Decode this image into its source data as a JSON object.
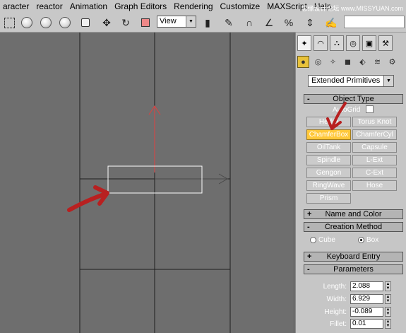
{
  "menubar": {
    "items": [
      "aracter",
      "reactor",
      "Animation",
      "Graph Editors",
      "Rendering",
      "Customize",
      "MAXScript",
      "Help"
    ],
    "watermark": "思缘设计论坛 www.MISSYUAN.com"
  },
  "toolbar": {
    "view_select": "View"
  },
  "panel": {
    "category_select": "Extended Primitives",
    "object_type": {
      "title": "Object Type",
      "sign": "-",
      "autogrid_label": "AutoGrid"
    },
    "buttons": [
      "Hedra",
      "Torus Knot",
      "ChamferBox",
      "ChamferCyl",
      "OilTank",
      "Capsule",
      "Spindle",
      "L-Ext",
      "Gengon",
      "C-Ext",
      "RingWave",
      "Hose",
      "Prism"
    ],
    "active_button": "ChamferBox",
    "name_and_color": {
      "title": "Name and Color",
      "sign": "+"
    },
    "creation_method": {
      "title": "Creation Method",
      "sign": "-",
      "options": [
        "Cube",
        "Box"
      ],
      "selected": "Box"
    },
    "keyboard_entry": {
      "title": "Keyboard Entry",
      "sign": "+"
    },
    "parameters": {
      "title": "Parameters",
      "sign": "-",
      "fields": [
        {
          "label": "Length:",
          "value": "2.088"
        },
        {
          "label": "Width:",
          "value": "6.929"
        },
        {
          "label": "Height:",
          "value": "-0.089"
        },
        {
          "label": "Fillet:",
          "value": "0.01"
        }
      ]
    }
  },
  "colors": {
    "ui_gray": "#c6c6c6",
    "viewport_gray": "#6e6e6e",
    "active_button": "#ffc83a",
    "annotation_arrow": "#b82020",
    "gizmo_y_axis": "#e04040"
  }
}
